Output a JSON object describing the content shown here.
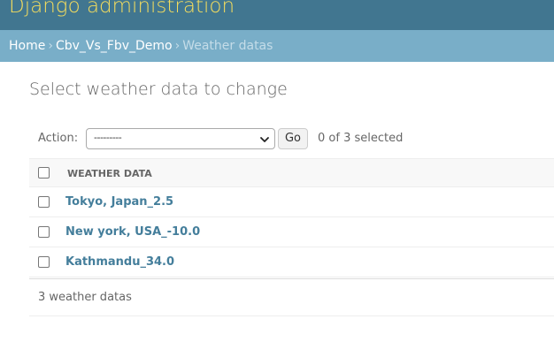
{
  "header": {
    "branding": "Django administration"
  },
  "breadcrumbs": {
    "home": "Home",
    "separator": "›",
    "app": "Cbv_Vs_Fbv_Demo",
    "current": "Weather datas"
  },
  "content": {
    "title": "Select weather data to change"
  },
  "actions": {
    "label": "Action:",
    "selected_option": "---------",
    "go_label": "Go",
    "counter": "0 of 3 selected"
  },
  "table": {
    "column_header": "WEATHER DATA",
    "rows": [
      "Tokyo, Japan_2.5",
      "New york, USA_-10.0",
      "Kathmandu_34.0"
    ]
  },
  "paginator": {
    "text": "3 weather datas"
  },
  "colors": {
    "header_bg": "#417690",
    "branding": "#f5dd5d",
    "breadcrumbs_bg": "#79aec8",
    "link": "#447e9b"
  }
}
